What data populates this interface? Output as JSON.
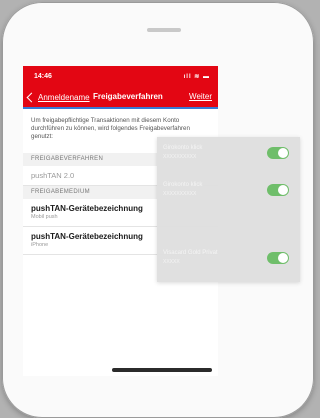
{
  "status_bar": {
    "time": "14:46",
    "icons": "ıll ≋ ▬"
  },
  "nav": {
    "back_label": "Anmeldename",
    "title": "Freigabeverfahren",
    "next_label": "Weiter"
  },
  "intro": "Um freigabepflichtige Transaktionen mit diesem Konto durchführen zu können, wird folgendes Freigabeverfahren genutzt:",
  "sections": {
    "verfahren_header": "FREIGABEVERFAHREN",
    "medium_header": "FREIGABEMEDIUM"
  },
  "verfahren_value": "pushTAN 2.0",
  "media": [
    {
      "title": "pushTAN-Gerätebezeichnung",
      "subtitle": "Mobil push"
    },
    {
      "title": "pushTAN-Gerätebezeichnung",
      "subtitle": "iPhone"
    }
  ],
  "accounts": [
    {
      "name": "Girokonto klick",
      "number": "XXXXXXXXXX",
      "enabled": true
    },
    {
      "name": "Girokonto klick",
      "number": "XXXXXXXXXX",
      "enabled": true
    },
    {
      "name": "Visacard Gold Privat",
      "number": "XXXXX",
      "enabled": true
    }
  ],
  "colors": {
    "brand_red": "#e30613",
    "toggle_on": "#6fbe6a"
  }
}
